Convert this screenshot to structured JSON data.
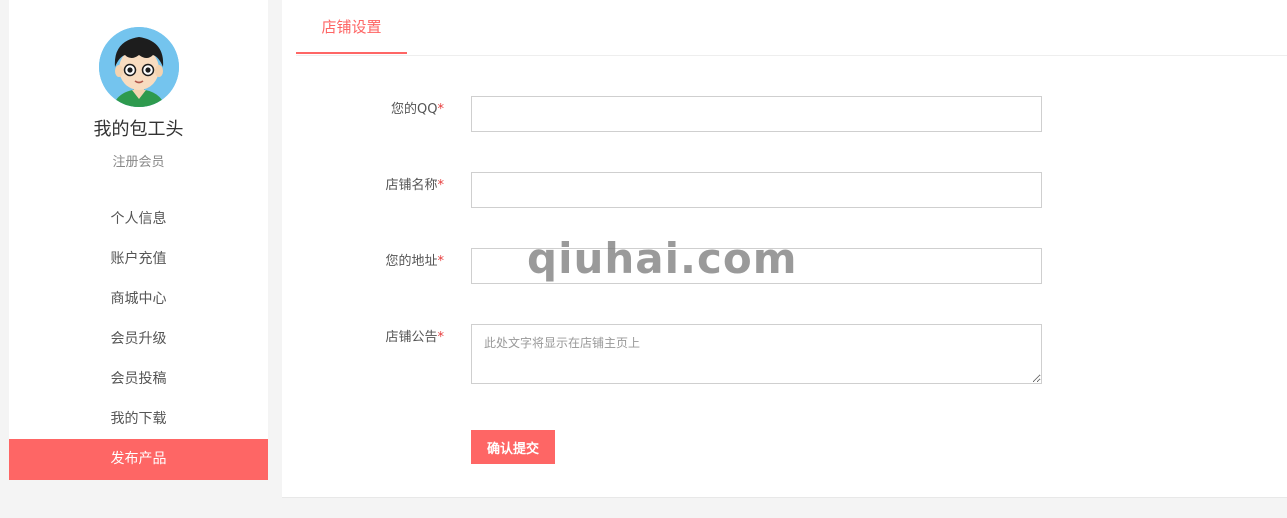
{
  "sidebar": {
    "avatar_icon": "cartoon-boy-avatar",
    "username": "我的包工头",
    "role": "注册会员",
    "menu": [
      {
        "label": "个人信息",
        "active": false
      },
      {
        "label": "账户充值",
        "active": false
      },
      {
        "label": "商城中心",
        "active": false
      },
      {
        "label": "会员升级",
        "active": false
      },
      {
        "label": "会员投稿",
        "active": false
      },
      {
        "label": "我的下载",
        "active": false
      },
      {
        "label": "发布产品",
        "active": true
      }
    ]
  },
  "main": {
    "tab": "店铺设置",
    "fields": [
      {
        "label": "您的QQ",
        "required_mark": "*",
        "value": "",
        "placeholder": ""
      },
      {
        "label": "店铺名称",
        "required_mark": "*",
        "value": "",
        "placeholder": ""
      },
      {
        "label": "您的地址",
        "required_mark": "*",
        "value": "",
        "placeholder": ""
      },
      {
        "label": "店铺公告",
        "required_mark": "*",
        "value": "",
        "placeholder": "此处文字将显示在店铺主页上"
      }
    ],
    "submit_label": "确认提交"
  },
  "watermark": "qiuhai.com",
  "colors": {
    "accent": "#fe6665",
    "page_background": "#f4f4f4",
    "panel_background": "#ffffff",
    "required": "#e63b3b"
  }
}
